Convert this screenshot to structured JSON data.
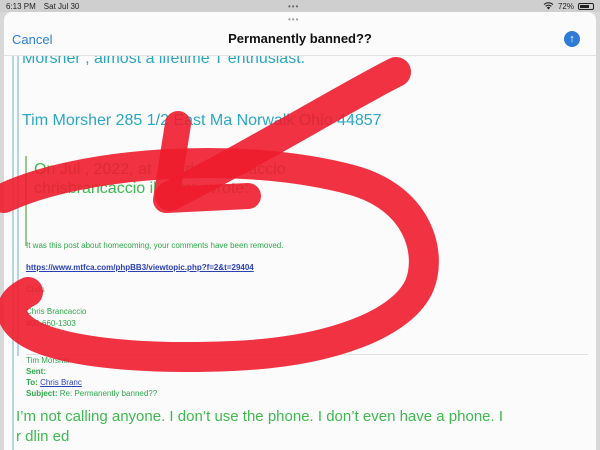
{
  "status_bar": {
    "time": "6:13 PM",
    "date": "Sat Jul 30",
    "dots": "•••",
    "wifi_icon": "wifi-icon",
    "battery_percent": "72%",
    "battery_level": 0.72
  },
  "nav": {
    "grabber": "•••",
    "cancel_label": "Cancel",
    "title": "Permanently banned??",
    "send_icon": "arrow-up-icon",
    "send_glyph": "↑"
  },
  "body": {
    "partial_line": "Morsher , almost a lifetime T enthusiast.",
    "address_line": "Tim Morsher 285 1/2 East Ma              Norwalk Ohio 44857",
    "quote_on_line": "On Jul       , 2022, at       , Chris Brancaccio",
    "quote_email_line": "chrisbrancaccio             il.com> wrote:",
    "post_line": "It was this post about homecoming, your comments have been removed.",
    "link": "https://www.mtfca.com/phpBB3/viewtopic.php?f=2&t=29404",
    "signoff": "Chris",
    "signature_name": "Chris Brancaccio",
    "signature_phone": "403-660-1303"
  },
  "forwarded_header": {
    "from": "Tim Morsher",
    "sent_label": "Sent:",
    "to_label": "To:",
    "to_name": "Chris Branc",
    "subject_label": "Subject:",
    "subject": "Re: Permanently banned??"
  },
  "reply": {
    "line1": "I’m not calling anyone.  I don’t use the phone.  I don’t even have a phone.   I",
    "line2": "r                          dlin                    ed"
  },
  "markup_color": "#ee1c2e"
}
